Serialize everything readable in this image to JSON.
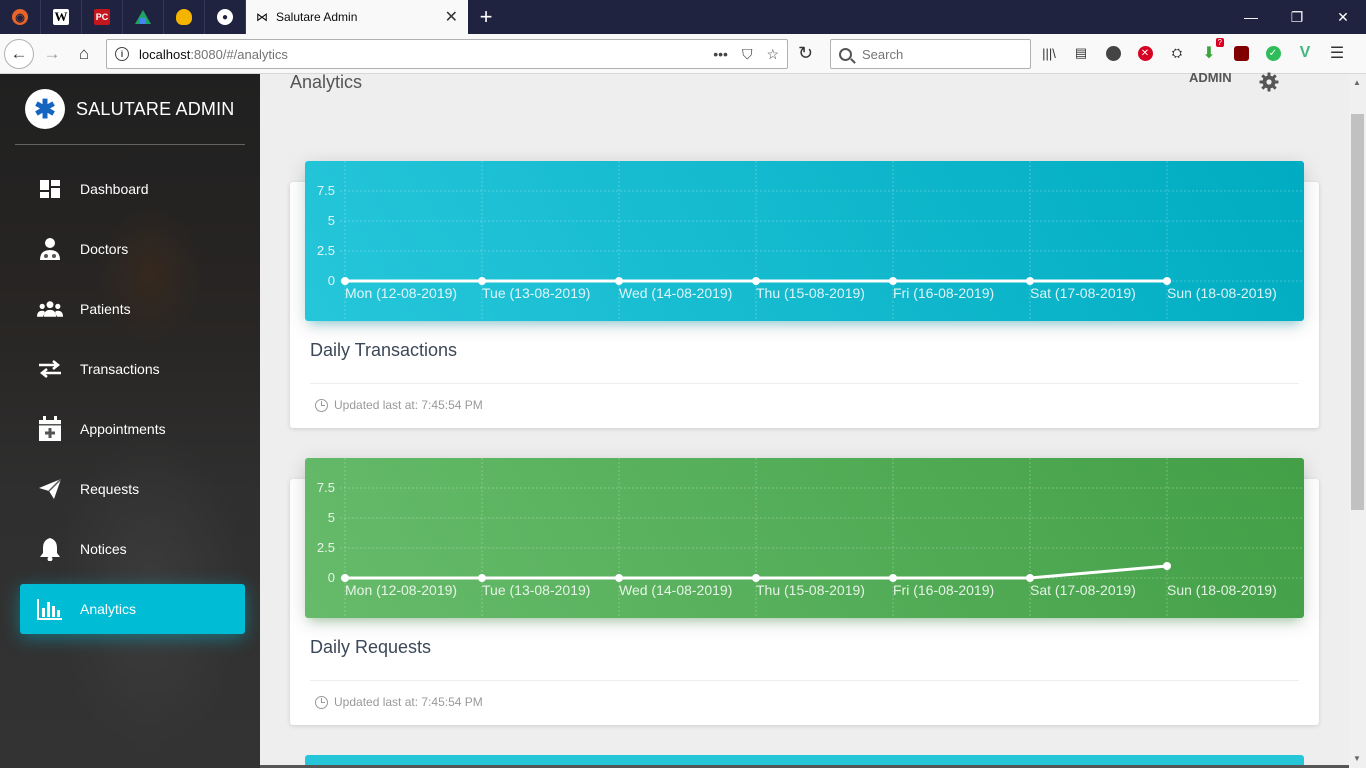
{
  "browser": {
    "tab_title": "Salutare Admin",
    "url_host": "localhost",
    "url_path": ":8080/#/analytics",
    "search_placeholder": "Search",
    "ublock_badge": "?",
    "pinned_tabs": [
      "firefox-icon",
      "wikipedia-icon",
      "pcgamer-icon",
      "google-drive-icon",
      "firebase-icon",
      "github-icon"
    ]
  },
  "sidebar": {
    "brand": "SALUTARE ADMIN",
    "items": [
      {
        "label": "Dashboard",
        "icon": "dashboard-icon"
      },
      {
        "label": "Doctors",
        "icon": "doctor-icon"
      },
      {
        "label": "Patients",
        "icon": "patients-icon"
      },
      {
        "label": "Transactions",
        "icon": "transactions-icon"
      },
      {
        "label": "Appointments",
        "icon": "appointments-icon"
      },
      {
        "label": "Requests",
        "icon": "send-icon"
      },
      {
        "label": "Notices",
        "icon": "bell-icon"
      },
      {
        "label": "Analytics",
        "icon": "chart-icon",
        "active": true
      }
    ],
    "active_color": "#00bcd4"
  },
  "header": {
    "title": "Analytics",
    "user": "ADMIN"
  },
  "cards": [
    {
      "title": "Daily Transactions",
      "updated": "Updated last at: 7:45:54 PM",
      "color": "#00bcd4"
    },
    {
      "title": "Daily Requests",
      "updated": "Updated last at: 7:45:54 PM",
      "color": "#4caf50"
    }
  ],
  "chart_data": [
    {
      "type": "line",
      "categories": [
        "Mon (12-08-2019)",
        "Tue (13-08-2019)",
        "Wed (14-08-2019)",
        "Thu (15-08-2019)",
        "Fri (16-08-2019)",
        "Sat (17-08-2019)",
        "Sun (18-08-2019)"
      ],
      "values": [
        0,
        0,
        0,
        0,
        0,
        0,
        0
      ],
      "yticks": [
        "0",
        "2.5",
        "5",
        "7.5"
      ],
      "ylim": [
        0,
        10
      ],
      "grid": true
    },
    {
      "type": "line",
      "categories": [
        "Mon (12-08-2019)",
        "Tue (13-08-2019)",
        "Wed (14-08-2019)",
        "Thu (15-08-2019)",
        "Fri (16-08-2019)",
        "Sat (17-08-2019)",
        "Sun (18-08-2019)"
      ],
      "values": [
        0,
        0,
        0,
        0,
        0,
        0,
        1
      ],
      "yticks": [
        "0",
        "2.5",
        "5",
        "7.5"
      ],
      "ylim": [
        0,
        10
      ],
      "grid": true
    }
  ]
}
